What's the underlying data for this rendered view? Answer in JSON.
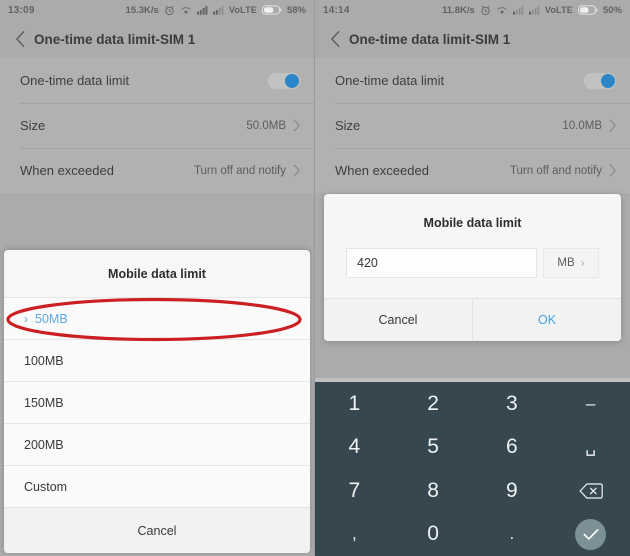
{
  "left_panel": {
    "status_bar": {
      "time": "13:09",
      "speed": "15.3K/s",
      "network": "VoLTE",
      "battery_percent": "58%",
      "icons": [
        "alarm-clock-icon",
        "wifi-icon",
        "signal-sim1-icon",
        "signal-sim2-icon",
        "battery-icon"
      ]
    },
    "app_bar": {
      "back_icon": "back-chevron-icon",
      "title": "One-time data limit-SIM 1"
    },
    "settings_rows": [
      {
        "label": "One-time data limit",
        "value": "",
        "type": "toggle",
        "toggle_on": true
      },
      {
        "label": "Size",
        "value": "50.0MB",
        "type": "nav"
      },
      {
        "label": "When exceeded",
        "value": "Turn off and notify",
        "type": "nav"
      }
    ],
    "sheet": {
      "title": "Mobile data limit",
      "options": [
        {
          "label": "50MB",
          "selected": true
        },
        {
          "label": "100MB",
          "selected": false
        },
        {
          "label": "150MB",
          "selected": false
        },
        {
          "label": "200MB",
          "selected": false
        },
        {
          "label": "Custom",
          "selected": false
        }
      ],
      "cancel_label": "Cancel"
    },
    "annotation": {
      "shape": "ellipse",
      "color": "#cc1f24",
      "target": "50MB option"
    }
  },
  "right_panel": {
    "status_bar": {
      "time": "14:14",
      "speed": "11.8K/s",
      "network": "VoLTE",
      "battery_percent": "50%",
      "icons": [
        "alarm-clock-icon",
        "wifi-icon",
        "signal-sim1-icon",
        "signal-sim2-icon",
        "battery-icon"
      ]
    },
    "app_bar": {
      "back_icon": "back-chevron-icon",
      "title": "One-time data limit-SIM 1"
    },
    "settings_rows": [
      {
        "label": "One-time data limit",
        "value": "",
        "type": "toggle",
        "toggle_on": true
      },
      {
        "label": "Size",
        "value": "10.0MB",
        "type": "nav"
      },
      {
        "label": "When exceeded",
        "value": "Turn off and notify",
        "type": "nav"
      }
    ],
    "dialog": {
      "title": "Mobile data limit",
      "input_value": "420",
      "input_placeholder": "",
      "unit_label": "MB",
      "unit_chevron": "›",
      "cancel_label": "Cancel",
      "ok_label": "OK"
    },
    "annotation": {
      "shape": "ellipse",
      "color": "#cc1f24",
      "target": "amount input and unit selector"
    },
    "keypad": {
      "keys": [
        {
          "label": "1",
          "name": "key-1"
        },
        {
          "label": "2",
          "name": "key-2"
        },
        {
          "label": "3",
          "name": "key-3"
        },
        {
          "label": "–",
          "name": "key-minus"
        },
        {
          "label": "4",
          "name": "key-4"
        },
        {
          "label": "5",
          "name": "key-5"
        },
        {
          "label": "6",
          "name": "key-6"
        },
        {
          "label": "␣",
          "name": "key-space"
        },
        {
          "label": "7",
          "name": "key-7"
        },
        {
          "label": "8",
          "name": "key-8"
        },
        {
          "label": "9",
          "name": "key-9"
        },
        {
          "label": "",
          "name": "key-backspace"
        },
        {
          "label": ",",
          "name": "key-comma"
        },
        {
          "label": "0",
          "name": "key-0"
        },
        {
          "label": ".",
          "name": "key-period"
        },
        {
          "label": "",
          "name": "key-enter"
        }
      ]
    }
  },
  "theme": {
    "accent_blue": "#2a86c8",
    "link_blue": "#4aa3e0",
    "annotation_red": "#cc1f24",
    "keypad_bg": "#36474f",
    "dim_bg": "#a9a9a9"
  }
}
